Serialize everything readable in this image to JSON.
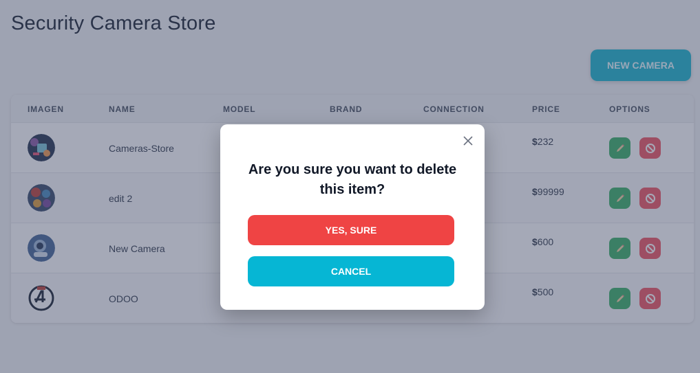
{
  "app": {
    "title": "Security Camera Store",
    "new_button_label": "NEW CAMERA"
  },
  "table": {
    "headers": [
      "IMAGEN",
      "NAME",
      "MODEL",
      "BRAND",
      "CONNECTION",
      "PRICE",
      "OPTIONS"
    ],
    "rows": [
      {
        "name": "Cameras-Store",
        "price": "232",
        "image_icon": "tea-cup-avatar"
      },
      {
        "name": "edit 2",
        "price": "99999",
        "image_icon": "comic-collage-avatar"
      },
      {
        "name": "New Camera",
        "price": "600",
        "image_icon": "astronaut-avatar"
      },
      {
        "name": "ODOO",
        "price": "500",
        "image_icon": "fantastic-four-logo"
      }
    ],
    "currency_symbol": "$"
  },
  "modal": {
    "message": "Are you sure you want to delete this item?",
    "confirm_label": "YES, SURE",
    "cancel_label": "CANCEL"
  },
  "colors": {
    "accent": "#22b8cf",
    "edit": "#3fb36a",
    "delete": "#f05a66",
    "confirm": "#ef4444",
    "cancel": "#06b6d4"
  }
}
